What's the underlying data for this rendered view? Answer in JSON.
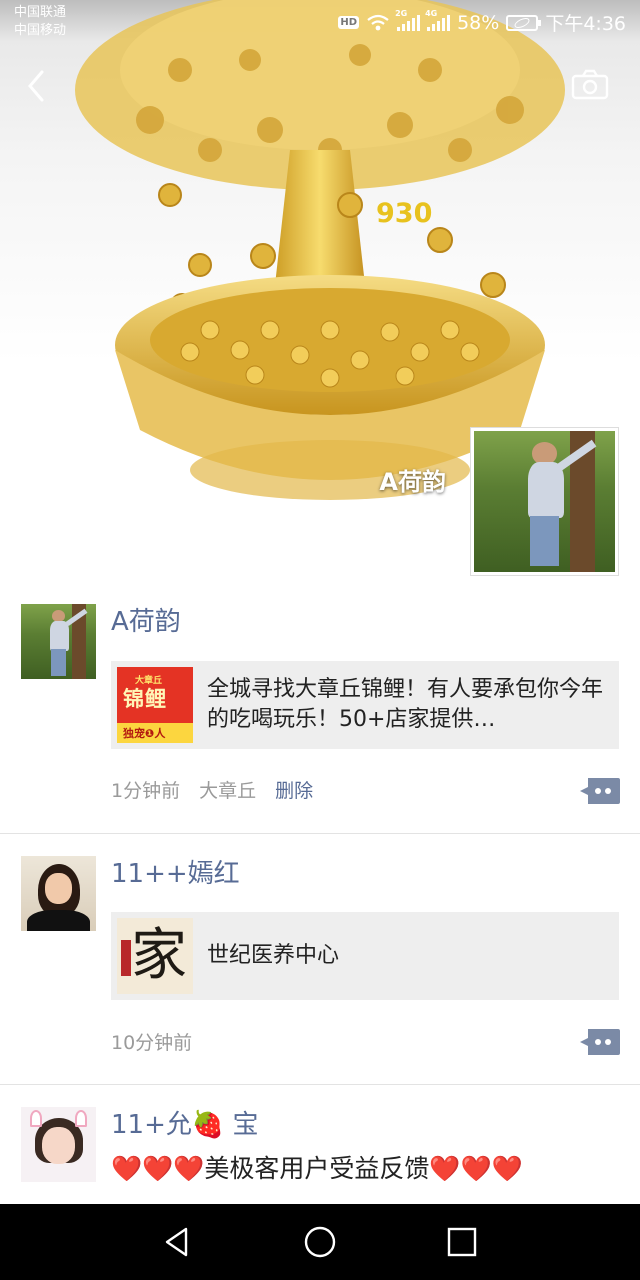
{
  "status_bar": {
    "carrier_1": "中国联通",
    "carrier_2": "中国移动",
    "hd_badge": "HD",
    "net_1": "2G",
    "net_2": "4G",
    "battery": "58%",
    "time": "下午4:36"
  },
  "cover": {
    "number_overlay": "930",
    "profile_name": "A荷韵"
  },
  "posts": [
    {
      "author": "A荷韵",
      "share": {
        "title": "全城寻找大章丘锦鲤！有人要承包你今年的吃喝玩乐！50+店家提供…",
        "thumb_tag": "大章丘",
        "thumb_big": "锦鲤",
        "thumb_bottom": "独宠❶人"
      },
      "time": "1分钟前",
      "location": "大章丘",
      "delete_label": "删除"
    },
    {
      "author": "11++嫣红",
      "share": {
        "title": "世纪医养中心",
        "thumb_big": "家"
      },
      "time": "10分钟前"
    },
    {
      "author": "11+允🍓 宝",
      "text_prefix": "❤️❤️❤️",
      "text_main": "美极客用户受益反馈",
      "text_suffix": "❤️❤️❤️"
    }
  ],
  "icons": {
    "back": "chevron-left-icon",
    "camera": "camera-icon",
    "comment": "comment-dots-icon",
    "nav_back": "triangle-back-icon",
    "nav_home": "circle-home-icon",
    "nav_recent": "square-recent-icon"
  },
  "colors": {
    "name_blue": "#576b95",
    "share_bg": "#eeeeee",
    "meta_gray": "#9a9a9a",
    "comment_btn": "#7b8aa6",
    "gold": "#e4b83a"
  }
}
